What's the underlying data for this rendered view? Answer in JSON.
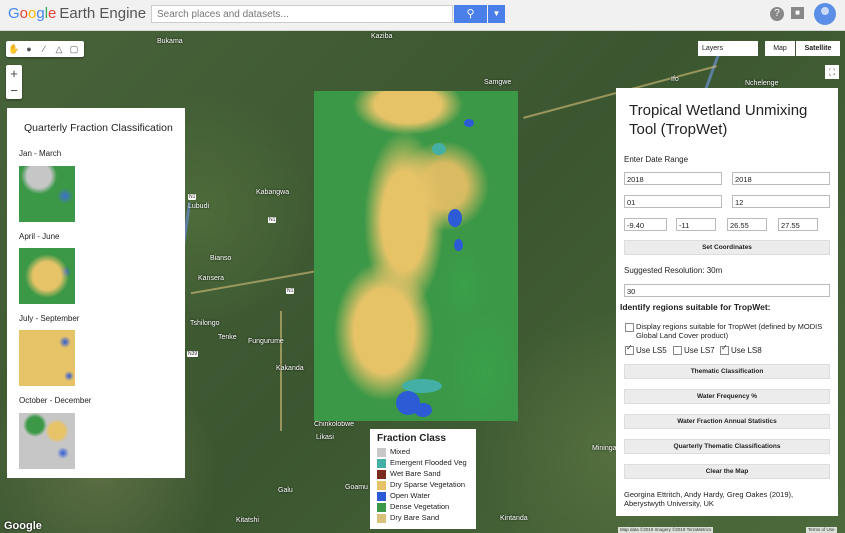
{
  "header": {
    "logo_letters": [
      "G",
      "o",
      "o",
      "g",
      "l",
      "e"
    ],
    "logo_suffix": "Earth Engine",
    "search_placeholder": "Search places and datasets...",
    "help_icon": "?"
  },
  "map_controls": {
    "layers_label": "Layers",
    "map_label": "Map",
    "satellite_label": "Satellite",
    "zoom_in": "+",
    "zoom_out": "−"
  },
  "places": {
    "bukama": "Bukama",
    "kabwe_top": "Kaziba",
    "samgwe": "Samgwe",
    "ifo_top": "Ifo",
    "nchelenge": "Nchelenge",
    "kabanga": "Kabangwa",
    "lubudi": "Lubudi",
    "bianso": "Bianso",
    "kansera": "Kansera",
    "tshilongo": "Tshilongo",
    "tenke": "Tenke",
    "fungurume": "Fungurume",
    "kakanda": "Kakanda",
    "chinkolobwe": "Chinkolobwe",
    "likasi": "Likasi",
    "mininga": "Mininga",
    "goamu": "Goamu",
    "galu": "Galu",
    "kitatshi": "Kitatshi",
    "kintanda": "Kintanda"
  },
  "left_panel": {
    "title": "Quarterly Fraction Classification",
    "quarters": [
      "Jan - March",
      "April - June",
      "July - September",
      "October - December"
    ]
  },
  "legend": {
    "title": "Fraction Class",
    "items": [
      {
        "label": "Mixed",
        "color": "#c8c8c8"
      },
      {
        "label": "Emergent Flooded Veg",
        "color": "#44b0a5"
      },
      {
        "label": "Wet Bare Sand",
        "color": "#7a2c1e"
      },
      {
        "label": "Dry Sparse Vegetation",
        "color": "#e7c368"
      },
      {
        "label": "Open Water",
        "color": "#2d5bd6"
      },
      {
        "label": "Dense Vegetation",
        "color": "#3b9847"
      },
      {
        "label": "Dry Bare Sand",
        "color": "#d8c27a"
      }
    ]
  },
  "right_panel": {
    "title": "Tropical Wetland Unmixing Tool (TropWet)",
    "date_range_label": "Enter Date Range",
    "start_year": "2018",
    "end_year": "2018",
    "start_month": "01",
    "end_month": "12",
    "coords": [
      "-9.40",
      "-11",
      "26.55",
      "27.55"
    ],
    "set_coords_button": "Set Coordinates",
    "resolution_label": "Suggested Resolution: 30m",
    "resolution_value": "30",
    "identify_label": "Identify regions suitable for TropWet:",
    "display_regions_label": "Display regions suitable for TropWet (defined by MODIS Global Land Cover product)",
    "ls5_label": "Use LS5",
    "ls7_label": "Use LS7",
    "ls8_label": "Use LS8",
    "buttons": {
      "thematic": "Thematic Classification",
      "water_freq": "Water Frequency %",
      "water_fraction": "Water Fraction Annual Statistics",
      "quarterly": "Quarterly Thematic Classifications",
      "clear": "Clear the Map"
    },
    "credits": "Georgina Ettritch, Andy Hardy, Greg Oakes (2019), Aberystwyth University, UK"
  },
  "footer": {
    "google": "Google",
    "attribution": "Map data ©2019 Imagery ©2019 TerraMetrics",
    "terms": "Terms of Use"
  }
}
